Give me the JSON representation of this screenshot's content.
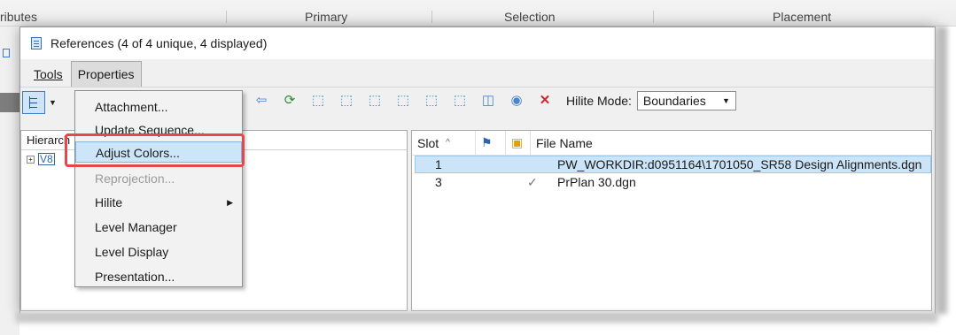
{
  "background": {
    "ribbon_labels": [
      "ributes",
      "Primary",
      "Selection",
      "Placement"
    ]
  },
  "dialog": {
    "title": "References (4 of 4 unique, 4 displayed)",
    "menu": {
      "tools": "Tools",
      "properties": "Properties"
    },
    "toolbar": {
      "hilite_label": "Hilite Mode:",
      "hilite_value": "Boundaries",
      "icons": [
        "attach-icon",
        "detach-icon",
        "reload-icon",
        "exchange-icon",
        "rotate-icon",
        "scale-icon",
        "move-icon",
        "copy-icon",
        "mirror-h-icon",
        "mirror-v-icon",
        "clip-boundary-icon",
        "clip-mask-icon",
        "delete-clip-icon"
      ]
    },
    "left_pane": {
      "header": "Hierarch",
      "tree_badge": "V8"
    },
    "right_pane": {
      "columns": {
        "slot": "Slot",
        "file_name": "File Name"
      },
      "rows": [
        {
          "slot": "1",
          "check": "",
          "file": "PW_WORKDIR:d0951164\\1701050_SR58 Design Alignments.dgn",
          "selected": true
        },
        {
          "slot": "3",
          "check": "✓",
          "file": "PrPlan 30.dgn",
          "selected": false
        }
      ]
    }
  },
  "dropdown": {
    "items": [
      {
        "label": "Attachment...",
        "state": "normal"
      },
      {
        "label": "Update Sequence...",
        "state": "normal"
      },
      {
        "label": "Adjust Colors...",
        "state": "highlight"
      },
      {
        "label": "Reprojection...",
        "state": "disabled"
      },
      {
        "label": "Hilite",
        "state": "submenu"
      },
      {
        "label": "Level Manager",
        "state": "normal"
      },
      {
        "label": "Level Display",
        "state": "normal"
      },
      {
        "label": "Presentation...",
        "state": "normal"
      }
    ]
  },
  "colors": {
    "highlight_bg": "#cde5f8",
    "callout_red": "#e6474b",
    "selected_row": "#cce4f7"
  }
}
